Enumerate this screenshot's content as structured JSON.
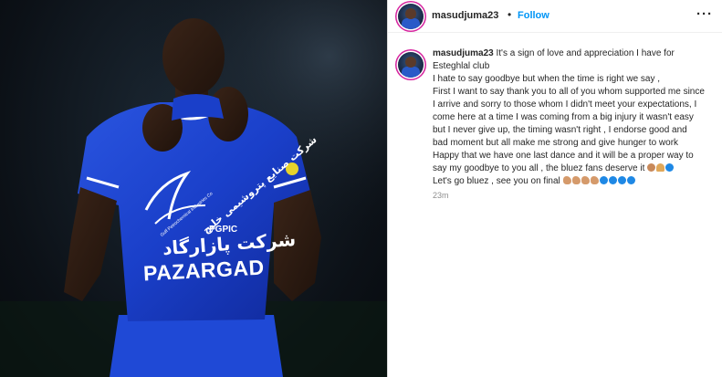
{
  "post": {
    "username": "masudjuma23",
    "dot": "•",
    "follow_label": "Follow",
    "more_label": "···",
    "timestamp": "23m"
  },
  "photo": {
    "jersey_main": "PAZARGAD",
    "jersey_sub": "PGPIC",
    "jersey_arabic": "شرکت پازارگاد",
    "jersey_arabic_top": "شرکت صنایع پتروشیمی خلیج",
    "jersey_small": "Gulf Petrochemical Industries Co"
  },
  "caption": {
    "username": "masudjuma23",
    "lines": [
      " It's a sign of love and appreciation I have for",
      "Esteghlal club",
      "I hate to say goodbye but when the time is right we say ,",
      "First I want to say thank you to all of you whom supported me since",
      "I arrive and sorry to those whom I didn't meet your expectations, I",
      "come here at a time I was coming from a big injury it wasn't easy",
      "but I never give up, the timing wasn't right , I endorse good and",
      "bad moment but all make me strong and give hunger to work",
      "Happy that we have one last dance and it will be a proper way to",
      "say my goodbye to you all , the bluez fans deserve it ",
      "Let's go bluez , see you on final "
    ],
    "line10_emojis": [
      "clap-emoji",
      "pray-emoji",
      "blue-circle-emoji"
    ],
    "line11_emojis": [
      "flexed-biceps-emoji",
      "flexed-biceps-emoji",
      "flexed-biceps-emoji",
      "flexed-biceps-emoji",
      "blue-circle-emoji",
      "blue-circle-emoji",
      "blue-circle-emoji",
      "blue-circle-emoji"
    ]
  },
  "colors": {
    "follow_blue": "#0095f6",
    "jersey_blue": "#1a3fc9",
    "story_ring": "#d6249f"
  }
}
